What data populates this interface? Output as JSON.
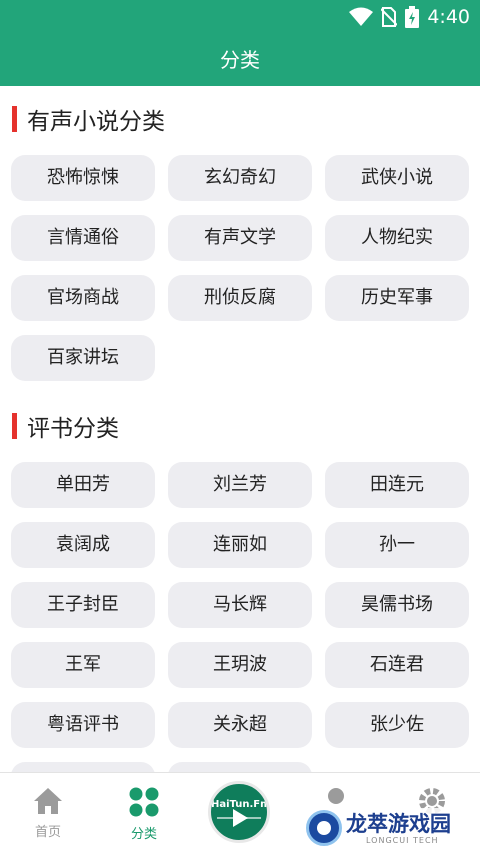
{
  "status_bar": {
    "time": "4:40"
  },
  "app_bar": {
    "title": "分类"
  },
  "sections": {
    "audio_novel": {
      "title": "有声小说分类",
      "items": [
        "恐怖惊悚",
        "玄幻奇幻",
        "武侠小说",
        "言情通俗",
        "有声文学",
        "人物纪实",
        "官场商战",
        "刑侦反腐",
        "历史军事",
        "百家讲坛"
      ]
    },
    "pingshu": {
      "title": "评书分类",
      "items": [
        "单田芳",
        "刘兰芳",
        "田连元",
        "袁阔成",
        "连丽如",
        "孙一",
        "王子封臣",
        "马长辉",
        "昊儒书场",
        "王军",
        "王玥波",
        "石连君",
        "粤语评书",
        "关永超",
        "张少佐"
      ]
    }
  },
  "bottom_nav": {
    "home": "首页",
    "category": "分类",
    "player": "HaiTun.Fm",
    "active_color": "#1a9a6c",
    "inactive_color": "#9b9b9b"
  },
  "watermark": {
    "text": "龙萃游戏园",
    "sub": "LONGCUI TECH"
  },
  "colors": {
    "primary": "#22a57a",
    "accent_bar": "#e5322d",
    "chip_bg": "#ededf1"
  }
}
